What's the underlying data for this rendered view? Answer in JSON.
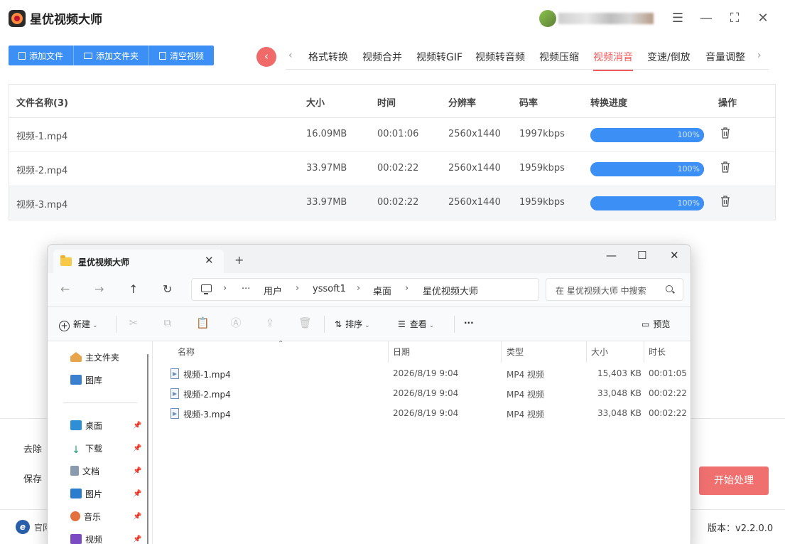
{
  "app": {
    "title": "星优视频大师",
    "toolbar": {
      "add_file": "添加文件",
      "add_folder": "添加文件夹",
      "clear": "清空视频"
    },
    "tabs": [
      {
        "label": "格式转换"
      },
      {
        "label": "视频合并"
      },
      {
        "label": "视频转GIF"
      },
      {
        "label": "视频转音频"
      },
      {
        "label": "视频压缩"
      },
      {
        "label": "视频消音",
        "active": true
      },
      {
        "label": "变速/倒放"
      },
      {
        "label": "音量调整"
      }
    ],
    "table": {
      "headers": {
        "name": "文件名称(3)",
        "size": "大小",
        "time": "时间",
        "resolution": "分辨率",
        "bitrate": "码率",
        "progress": "转换进度",
        "action": "操作"
      },
      "rows": [
        {
          "name": "视频-1.mp4",
          "size": "16.09MB",
          "time": "00:01:06",
          "resolution": "2560x1440",
          "bitrate": "1997kbps",
          "progress": 100,
          "progress_label": "100%"
        },
        {
          "name": "视频-2.mp4",
          "size": "33.97MB",
          "time": "00:02:22",
          "resolution": "2560x1440",
          "bitrate": "1959kbps",
          "progress": 100,
          "progress_label": "100%"
        },
        {
          "name": "视频-3.mp4",
          "size": "33.97MB",
          "time": "00:02:22",
          "resolution": "2560x1440",
          "bitrate": "1959kbps",
          "progress": 100,
          "progress_label": "100%"
        }
      ]
    },
    "settings": {
      "remove_label": "去除",
      "save_label": "保存"
    },
    "start_button": "开始处理",
    "footer": {
      "site_label": "官网",
      "version": "版本：v2.2.0.0"
    }
  },
  "explorer": {
    "tab_title": "星优视频大师",
    "breadcrumb": [
      "用户",
      "yssoft1",
      "桌面",
      "星优视频大师"
    ],
    "breadcrumb_more": "···",
    "search_placeholder": "在 星优视频大师 中搜索",
    "commands": {
      "new": "新建",
      "sort": "排序",
      "view": "查看",
      "more": "···",
      "preview": "预览"
    },
    "nav": {
      "home": "主文件夹",
      "gallery": "图库",
      "desktop": "桌面",
      "downloads": "下载",
      "documents": "文档",
      "pictures": "图片",
      "music": "音乐",
      "videos": "视频"
    },
    "columns": {
      "name": "名称",
      "date": "日期",
      "type": "类型",
      "size": "大小",
      "duration": "时长"
    },
    "files": [
      {
        "name": "视频-1.mp4",
        "date": "2026/8/19 9:04",
        "type": "MP4 视频",
        "size": "15,403 KB",
        "duration": "00:01:05"
      },
      {
        "name": "视频-2.mp4",
        "date": "2026/8/19 9:04",
        "type": "MP4 视频",
        "size": "33,048 KB",
        "duration": "00:02:22"
      },
      {
        "name": "视频-3.mp4",
        "date": "2026/8/19 9:04",
        "type": "MP4 视频",
        "size": "33,048 KB",
        "duration": "00:02:22"
      }
    ]
  },
  "colors": {
    "accent_blue": "#3b8ff5",
    "accent_red": "#f05a5a",
    "start_button": "#f07070"
  }
}
